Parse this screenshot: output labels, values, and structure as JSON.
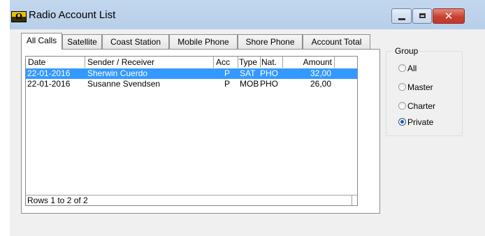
{
  "window": {
    "title": "Radio Account List",
    "controls": {
      "minimize": "minimize",
      "maximize": "maximize",
      "close": "✕"
    }
  },
  "tabs": [
    {
      "label": "All Calls",
      "active": true
    },
    {
      "label": "Satellite",
      "active": false
    },
    {
      "label": "Coast Station",
      "active": false
    },
    {
      "label": "Mobile Phone",
      "active": false
    },
    {
      "label": "Shore Phone",
      "active": false
    },
    {
      "label": "Account Total",
      "active": false
    }
  ],
  "list": {
    "columns": [
      {
        "label": "Date"
      },
      {
        "label": "Sender / Receiver"
      },
      {
        "label": "Acc"
      },
      {
        "label": "Type"
      },
      {
        "label": "Nat."
      },
      {
        "label": "Amount"
      }
    ],
    "rows": [
      {
        "date": "22-01-2016",
        "party": "Sherwin Cuerdo",
        "acc": "P",
        "type": "SAT",
        "nat": "PHO",
        "amount": "32,00",
        "selected": true
      },
      {
        "date": "22-01-2016",
        "party": "Susanne Svendsen",
        "acc": "P",
        "type": "MOB",
        "nat": "PHO",
        "amount": "26,00",
        "selected": false
      }
    ],
    "status": "Rows 1 to 2 of 2"
  },
  "group": {
    "title": "Group",
    "options": [
      {
        "label": "All",
        "checked": false
      },
      {
        "label": "Master",
        "checked": false
      },
      {
        "label": "Charter",
        "checked": false
      },
      {
        "label": "Private",
        "checked": true
      }
    ]
  },
  "colors": {
    "selection": "#3399ff",
    "titlebar": "#c2d7ee",
    "close_button": "#c8412f"
  }
}
